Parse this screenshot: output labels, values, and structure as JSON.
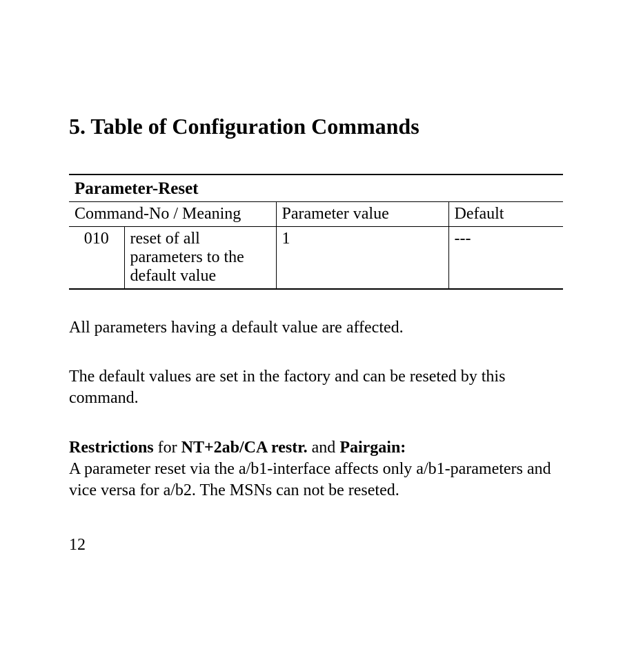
{
  "heading": {
    "number": "5.",
    "title": "Table of Configuration Commands"
  },
  "table": {
    "title": "Parameter-Reset",
    "headers": {
      "colspan12": "Command-No / Meaning",
      "col3": "Parameter value",
      "col4": "Default"
    },
    "row": {
      "cmdno": "010",
      "meaning": "reset of all parameters to the default value",
      "paramval": "1",
      "defaultval": "---"
    }
  },
  "paragraphs": {
    "p1": "All parameters having a default value are affected.",
    "p2": "The default values are set in the factory and can be reseted by this command.",
    "p3": {
      "b1": "Restrictions",
      "t1": " for ",
      "b2": "NT+2ab/CA restr.",
      "t2": " and ",
      "b3": "Pairgain:",
      "rest": "A parameter reset via the a/b1-interface affects only a/b1-parameters and vice versa for a/b2. The MSNs can not be reseted."
    }
  },
  "pageNumber": "12"
}
